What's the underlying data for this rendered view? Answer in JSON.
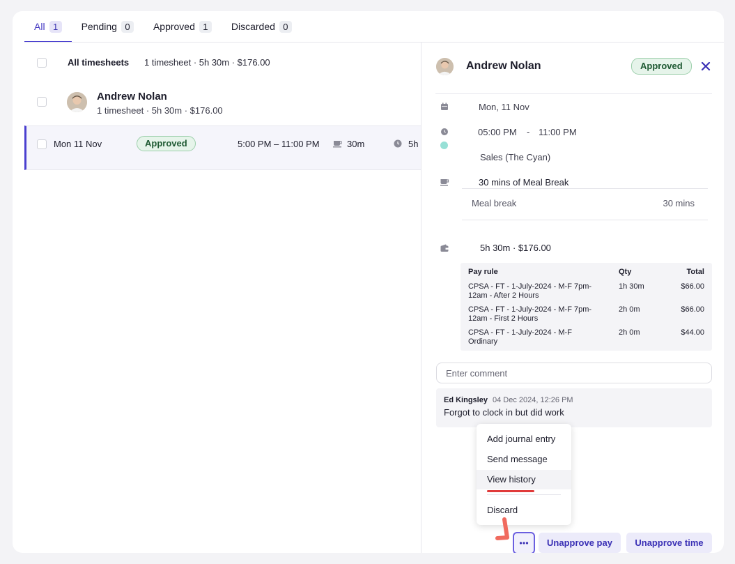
{
  "tabs": [
    {
      "label": "All",
      "count": "1"
    },
    {
      "label": "Pending",
      "count": "0"
    },
    {
      "label": "Approved",
      "count": "1"
    },
    {
      "label": "Discarded",
      "count": "0"
    }
  ],
  "list": {
    "all_title": "All timesheets",
    "all_summary": "1 timesheet · 5h 30m · $176.00",
    "employee": {
      "name": "Andrew Nolan",
      "summary": "1 timesheet · 5h 30m · $176.00"
    },
    "timesheet": {
      "date": "Mon 11 Nov",
      "status": "Approved",
      "time": "5:00 PM – 11:00 PM",
      "break": "30m",
      "hours": "5h"
    }
  },
  "panel": {
    "name": "Andrew Nolan",
    "status": "Approved",
    "date": "Mon, 11 Nov",
    "start": "05:00 PM",
    "dash": "-",
    "end": "11:00 PM",
    "location": "Sales (The Cyan)",
    "break_title": "30 mins of Meal Break",
    "break_label": "Meal break",
    "break_value": "30 mins",
    "total": "5h 30m  · $176.00",
    "pay_table": {
      "headers": [
        "Pay rule",
        "Qty",
        "Total"
      ],
      "rows": [
        {
          "rule_l1": "CPSA - FT - 1-July-2024 - M-F 7pm-",
          "rule_l2": "12am - After 2 Hours",
          "qty": "1h 30m",
          "total": "$66.00"
        },
        {
          "rule_l1": "CPSA - FT - 1-July-2024 - M-F 7pm-",
          "rule_l2": "12am - First 2 Hours",
          "qty": "2h 0m",
          "total": "$66.00"
        },
        {
          "rule_l1": "CPSA - FT - 1-July-2024 - M-F",
          "rule_l2": "Ordinary",
          "qty": "2h 0m",
          "total": "$44.00"
        }
      ]
    },
    "comment_placeholder": "Enter comment",
    "comment": {
      "author": "Ed Kingsley",
      "time": "04 Dec 2024, 12:26 PM",
      "text": "Forgot to clock in but did work"
    },
    "menu": [
      "Add journal entry",
      "Send message",
      "View history",
      "Discard"
    ],
    "more_label": "···",
    "btn_unapprove_pay": "Unapprove pay",
    "btn_unapprove_time": "Unapprove time"
  },
  "colors": {
    "accent": "#4a3fcf",
    "approved_bg": "#e6f4ea",
    "approved_border": "#9ccfab",
    "location_dot": "#97e0d6",
    "annotation": "#e03a3a"
  }
}
